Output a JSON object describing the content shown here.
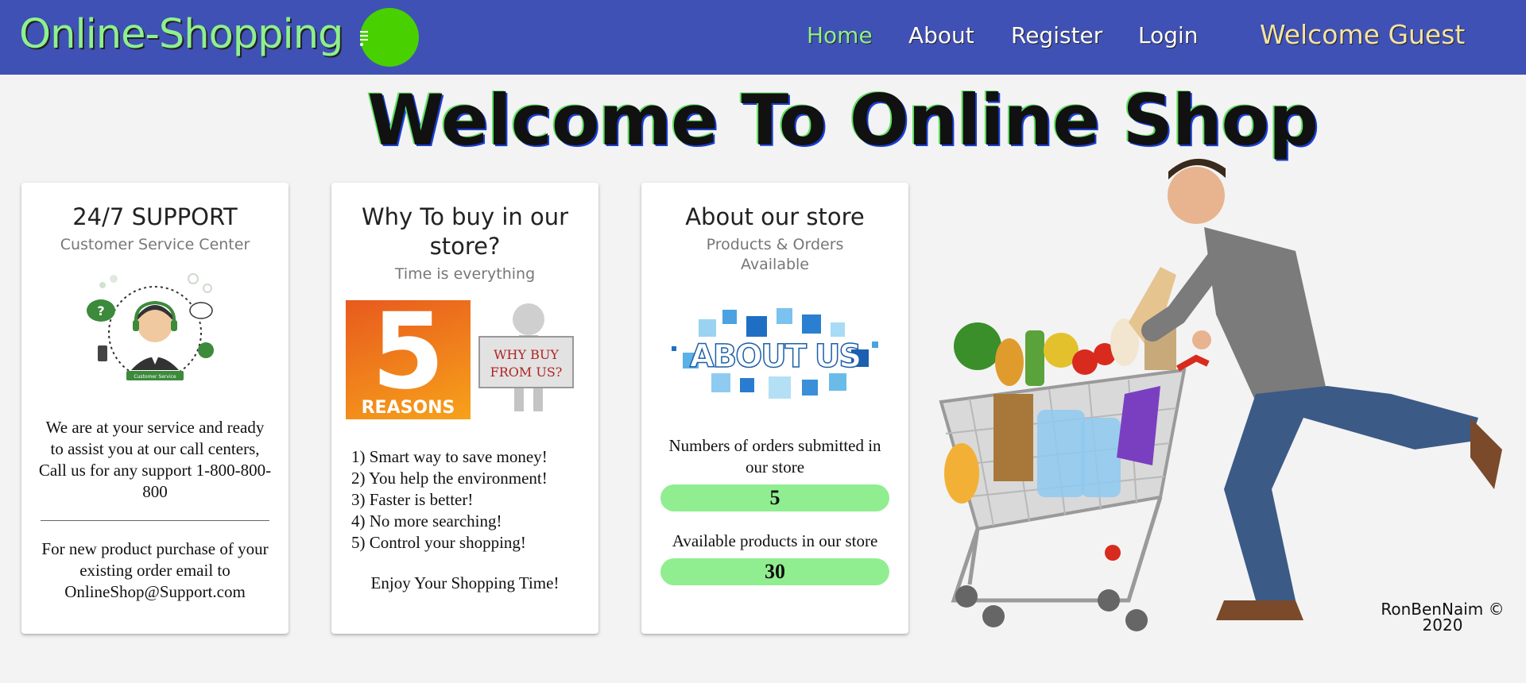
{
  "navbar": {
    "brand": "Online-Shopping",
    "links": [
      {
        "label": "Home",
        "active": true
      },
      {
        "label": "About",
        "active": false
      },
      {
        "label": "Register",
        "active": false
      },
      {
        "label": "Login",
        "active": false
      }
    ],
    "welcome": "Welcome Guest"
  },
  "hero": {
    "title": "Welcome To Online Shop"
  },
  "cards": {
    "support": {
      "title": "24/7 SUPPORT",
      "subtitle": "Customer Service Center",
      "text1": "We are at your service and ready to assist you at our call centers, Call us for any support 1-800-800-800",
      "text2": "For new product purchase of your existing order email to OnlineShop@Support.com",
      "image_text": "Customer Service"
    },
    "why": {
      "title": "Why To buy in our store?",
      "subtitle": "Time is everything",
      "image_number": "5",
      "image_label": "REASONS",
      "sign_line1": "WHY BUY",
      "sign_line2": "FROM US?",
      "reasons": [
        "1) Smart way to save money!",
        "2) You help the environment!",
        "3) Faster is better!",
        "4) No more searching!",
        "5) Control your shopping!"
      ],
      "enjoy": "Enjoy Your Shopping Time!"
    },
    "about": {
      "title": "About our store",
      "subtitle": "Products & Orders Available",
      "image_text": "ABOUT US",
      "orders_label": "Numbers of orders submitted in our store",
      "orders_count": "5",
      "products_label": "Available products in our store",
      "products_count": "30"
    }
  },
  "footer": {
    "copyright": "RonBenNaim © 2020"
  },
  "colors": {
    "navbar": "#3f51b5",
    "brand": "#8ef08e",
    "welcome": "#f4e3a4",
    "pill": "#90ee90",
    "logo": "#49d000"
  }
}
